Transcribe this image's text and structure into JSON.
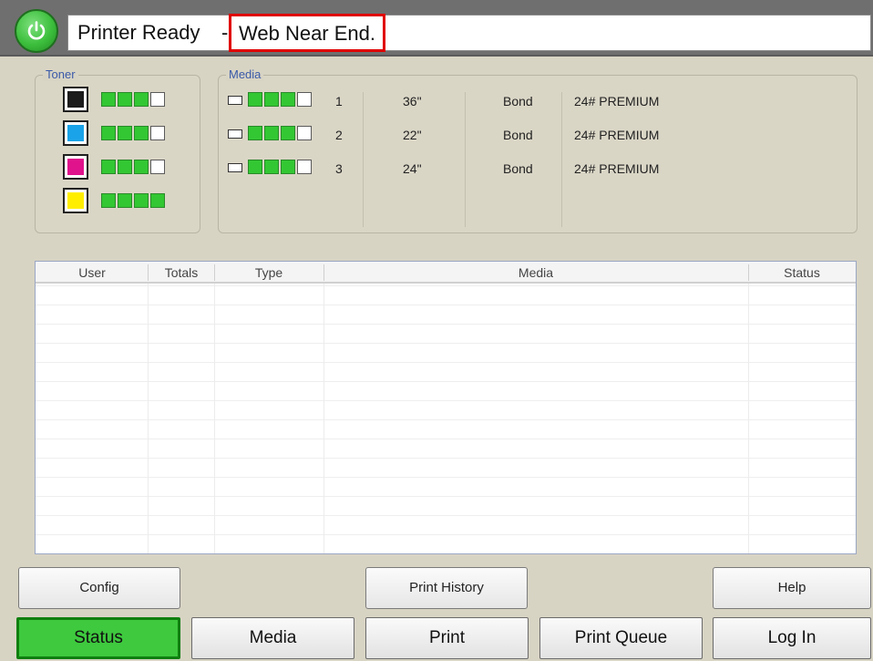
{
  "status": {
    "ready_text": "Printer Ready",
    "separator": "-",
    "warning_text": "Web Near End."
  },
  "toner": {
    "label": "Toner",
    "items": [
      {
        "color": "#1c1c1c",
        "level": 3,
        "max": 4
      },
      {
        "color": "#1aa3e8",
        "level": 3,
        "max": 4
      },
      {
        "color": "#e0128c",
        "level": 3,
        "max": 4
      },
      {
        "color": "#ffee00",
        "level": 4,
        "max": 4
      }
    ]
  },
  "media": {
    "label": "Media",
    "rolls": [
      {
        "number": "1",
        "width": "36\"",
        "type": "Bond",
        "description": "24# PREMIUM",
        "level": 3,
        "max": 4
      },
      {
        "number": "2",
        "width": "22\"",
        "type": "Bond",
        "description": "24# PREMIUM",
        "level": 3,
        "max": 4
      },
      {
        "number": "3",
        "width": "24\"",
        "type": "Bond",
        "description": "24# PREMIUM",
        "level": 3,
        "max": 4
      }
    ]
  },
  "jobs": {
    "columns": [
      "User",
      "Totals",
      "Type",
      "Media",
      "Status"
    ],
    "rows": []
  },
  "actions": {
    "config": "Config",
    "print_history": "Print History",
    "help": "Help"
  },
  "nav": {
    "status": "Status",
    "media": "Media",
    "print": "Print",
    "print_queue": "Print Queue",
    "log_in": "Log In"
  },
  "colors": {
    "level_on": "#33c733",
    "active_tab": "#3ec93e",
    "warning_border": "#e00000",
    "group_label": "#3a5aa8"
  },
  "icons": [
    "power-icon",
    "roll-icon"
  ]
}
